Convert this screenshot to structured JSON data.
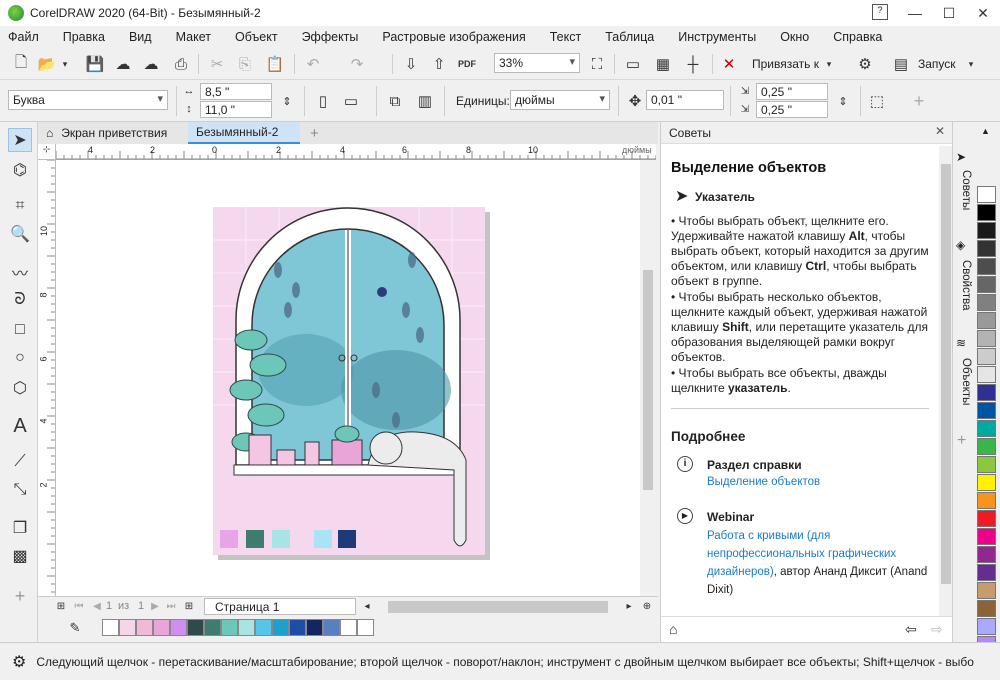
{
  "window": {
    "title": "CorelDRAW 2020 (64-Bit) - Безымянный-2"
  },
  "menu": [
    "Файл",
    "Правка",
    "Вид",
    "Макет",
    "Объект",
    "Эффекты",
    "Растровые изображения",
    "Текст",
    "Таблица",
    "Инструменты",
    "Окно",
    "Справка"
  ],
  "toolbar": {
    "zoom": "33%",
    "snap_label": "Привязать к",
    "launch_label": "Запуск",
    "pdf_label": "PDF"
  },
  "propbar": {
    "paper": "Буква",
    "width": "8,5 \"",
    "height": "11,0 \"",
    "units_label": "Единицы:",
    "units": "дюймы",
    "nudge": "0,01 \"",
    "dup_x": "0,25 \"",
    "dup_y": "0,25 \""
  },
  "tabs": {
    "welcome": "Экран приветствия",
    "doc": "Безымянный-2"
  },
  "ruler": {
    "h_ticks": [
      "4",
      "2",
      "0",
      "2",
      "4",
      "6",
      "8",
      "10"
    ],
    "unit": "дюймы",
    "v_ticks": [
      "10",
      "8",
      "6",
      "4",
      "2"
    ]
  },
  "pagenav": {
    "pos": "1",
    "of": "из",
    "total": "1",
    "page": "Страница 1"
  },
  "docker": {
    "header": "Советы",
    "title": "Выделение объектов",
    "tool_name": "Указатель",
    "tip1_a": "Чтобы выбрать объект, щелкните его. Удерживайте нажатой клавишу ",
    "tip1_key1": "Alt",
    "tip1_b": ", чтобы выбрать объект, который находится за другим объектом, или клавишу ",
    "tip1_key2": "Ctrl",
    "tip1_c": ", чтобы выбрать объект в группе.",
    "tip2_a": "Чтобы выбрать несколько объектов, щелкните каждый объект, удерживая нажатой клавишу ",
    "tip2_key": "Shift",
    "tip2_b": ", или перетащите указатель для образования выделяющей рамки вокруг объектов.",
    "tip3_a": "Чтобы выбрать все объекты, дважды щелкните ",
    "tip3_key": "указатель",
    "tip3_b": ".",
    "more_title": "Подробнее",
    "help_title": "Раздел справки",
    "help_link": "Выделение объектов",
    "webinar_title": "Webinar",
    "webinar_link": "Работа с кривыми (для непрофессиональных графических дизайнеров)",
    "webinar_author": ", автор Ананд Диксит (Anand Dixit)"
  },
  "sidetabs": [
    "Советы",
    "Свойства",
    "Объекты"
  ],
  "status": "Следующий щелчок - перетаскивание/масштабирование; второй щелчок - поворот/наклон; инструмент с двойным щелчком выбирает все объекты; Shift+щелчок - выбо",
  "colors": {
    "bottom_palette": [
      "#ffffff",
      "#f5d6e8",
      "#f0b9d8",
      "#e9a4d8",
      "#d08ef0",
      "#2f4a4a",
      "#3d7c6e",
      "#6cc7b9",
      "#a8e4e6",
      "#55c6e8",
      "#1f9fd0",
      "#1e4ea8",
      "#13275e",
      "#5a7fc0",
      "#ffffff",
      "#ffffff"
    ],
    "right_palette": [
      "#ffffff",
      "#000000",
      "#1a1a1a",
      "#333333",
      "#4d4d4d",
      "#666666",
      "#808080",
      "#999999",
      "#b3b3b3",
      "#cccccc",
      "#e6e6e6",
      "#2e3192",
      "#0054a6",
      "#00a99d",
      "#39b54a",
      "#8dc63f",
      "#fff200",
      "#f7941d",
      "#ed1c24",
      "#ec008c",
      "#92278f",
      "#662d91",
      "#c69c6d",
      "#8c6239",
      "#a9a9ff",
      "#b388ff"
    ],
    "art_swatches": [
      "#e9a4e8",
      "#3d7c6e",
      "#a8e4e6",
      "#a8e4f6",
      "#1e3a7a"
    ]
  }
}
